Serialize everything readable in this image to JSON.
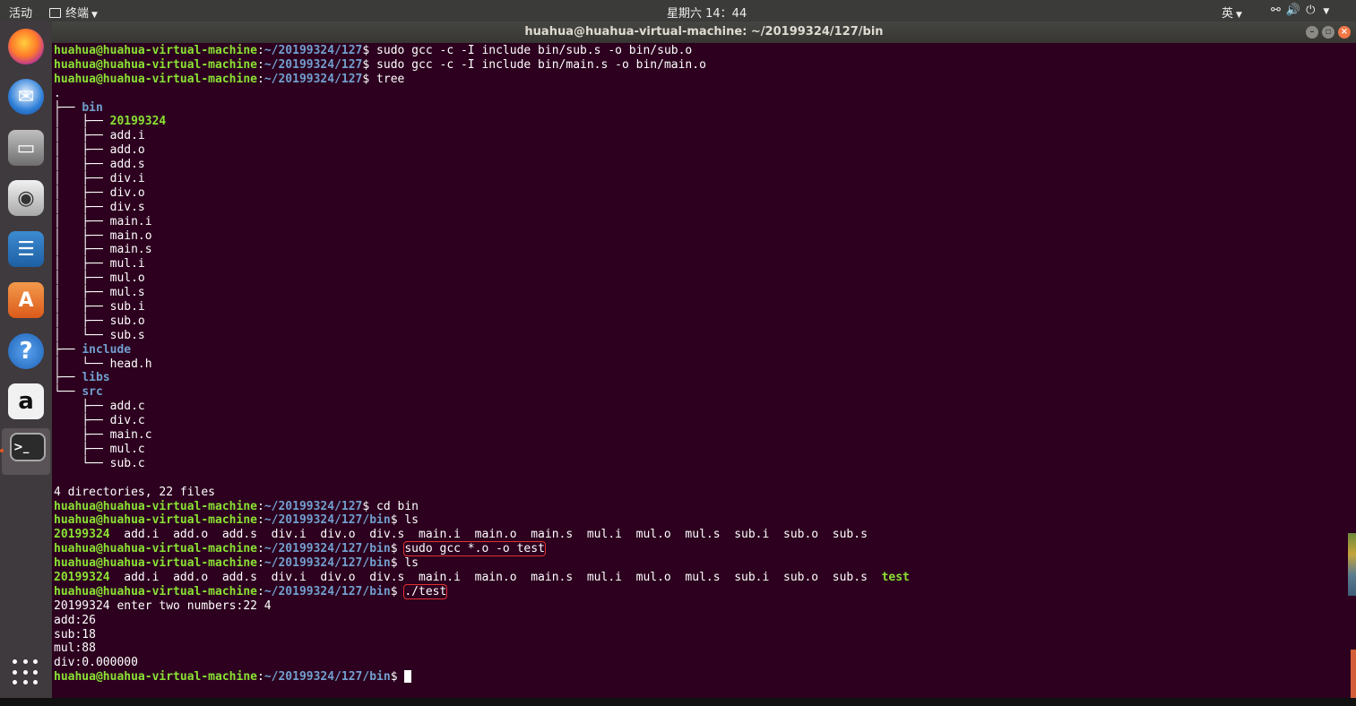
{
  "topbar": {
    "activities": "活动",
    "app_menu": "终端",
    "clock": "星期六 14：44",
    "input_method": "英"
  },
  "window": {
    "title": "huahua@huahua-virtual-machine: ~/20199324/127/bin"
  },
  "prompt": {
    "user": "huahua@huahua-virtual-machine",
    "path_root": "~/20199324/127",
    "path_bin": "~/20199324/127/bin"
  },
  "commands": {
    "c1": "sudo gcc -c -I include bin/sub.s -o bin/sub.o",
    "c2": "sudo gcc -c -I include bin/main.s -o bin/main.o",
    "c3": "tree",
    "c4": "cd bin",
    "c5": "ls",
    "c6": "sudo gcc *.o -o test",
    "c7": "ls",
    "c8": "./test"
  },
  "tree": {
    "root": ".",
    "bin": "bin",
    "bin_items": [
      "20199324",
      "add.i",
      "add.o",
      "add.s",
      "div.i",
      "div.o",
      "div.s",
      "main.i",
      "main.o",
      "main.s",
      "mul.i",
      "mul.o",
      "mul.s",
      "sub.i",
      "sub.o",
      "sub.s"
    ],
    "include": "include",
    "include_items": [
      "head.h"
    ],
    "libs": "libs",
    "src": "src",
    "src_items": [
      "add.c",
      "div.c",
      "main.c",
      "mul.c",
      "sub.c"
    ],
    "summary": "4 directories, 22 files"
  },
  "ls1": {
    "exe": "20199324",
    "files": "add.i  add.o  add.s  div.i  div.o  div.s  main.i  main.o  main.s  mul.i  mul.o  mul.s  sub.i  sub.o  sub.s"
  },
  "ls2": {
    "exe": "20199324",
    "files": "add.i  add.o  add.s  div.i  div.o  div.s  main.i  main.o  main.s  mul.i  mul.o  mul.s  sub.i  sub.o  sub.s",
    "exe2": "test"
  },
  "output": {
    "o1": "20199324 enter two numbers:22 4",
    "o2": "add:26",
    "o3": "sub:18",
    "o4": "mul:88",
    "o5": "div:0.000000"
  },
  "colors": {
    "background": "#2c001e",
    "prompt_user": "#8ae234",
    "prompt_path": "#729fcf",
    "highlight_box": "#e23131"
  },
  "icons": [
    "firefox-icon",
    "thunderbird-icon",
    "files-icon",
    "rhythmbox-icon",
    "writer-icon",
    "software-center-icon",
    "help-icon",
    "amazon-icon",
    "terminal-icon",
    "app-grid-icon"
  ]
}
